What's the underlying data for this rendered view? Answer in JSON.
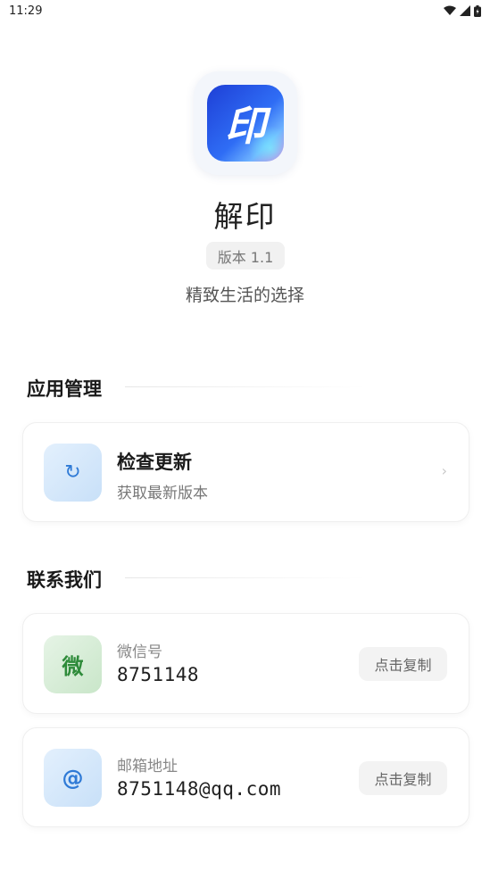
{
  "status_bar": {
    "time": "11:29"
  },
  "app": {
    "icon_glyph": "印",
    "name": "解印",
    "version": "版本 1.1",
    "tagline": "精致生活的选择",
    "brand_colors": [
      "#1e3fd6",
      "#2f6df5",
      "#6fb4ff",
      "#e86ad6"
    ]
  },
  "sections": {
    "app_management": {
      "title": "应用管理",
      "update_card": {
        "icon": "refresh-icon",
        "icon_glyph": "↻",
        "title": "检查更新",
        "subtitle": "获取最新版本",
        "chevron": "›"
      }
    },
    "contact": {
      "title": "联系我们",
      "wechat": {
        "icon_glyph": "微",
        "label": "微信号",
        "value": "8751148",
        "copy_label": "点击复制"
      },
      "email": {
        "icon_glyph": "@",
        "label": "邮箱地址",
        "value": "8751148@qq.com",
        "copy_label": "点击复制"
      }
    }
  }
}
